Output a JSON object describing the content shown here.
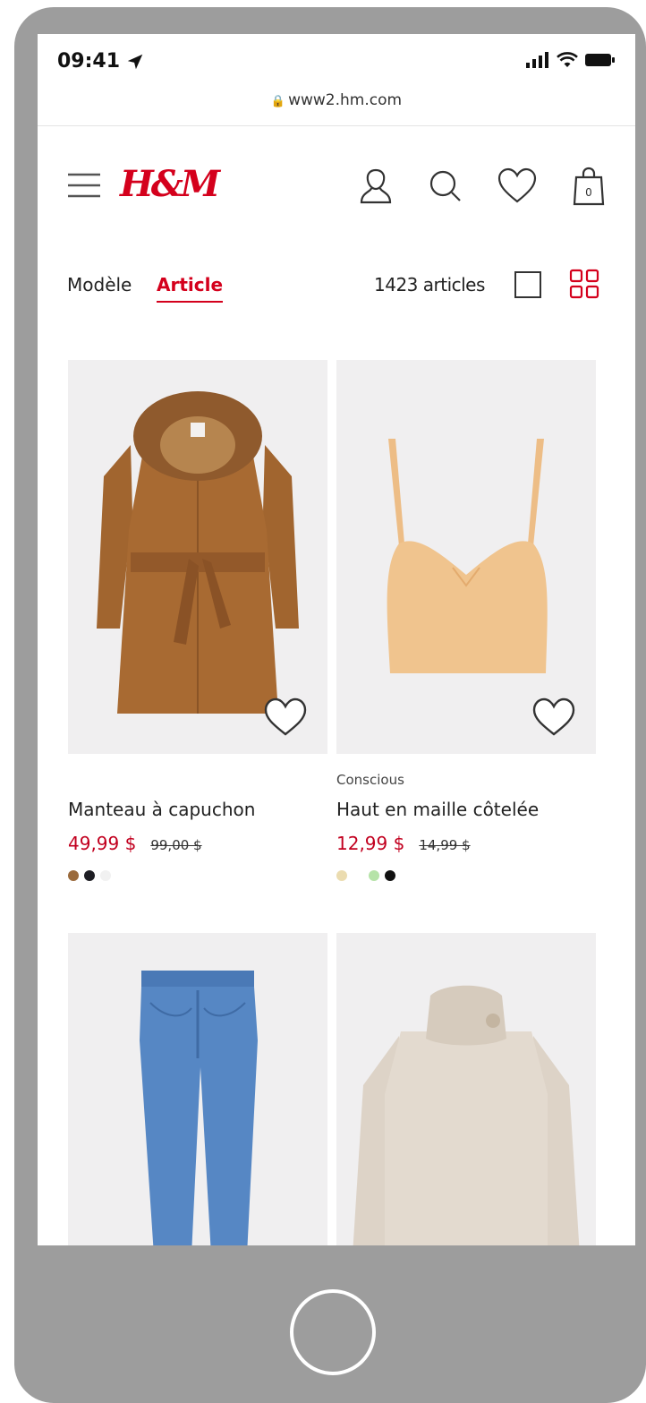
{
  "status_bar": {
    "time": "09:41",
    "url": "www2.hm.com"
  },
  "header": {
    "logo": "H&M",
    "icons": [
      "menu-icon",
      "account-icon",
      "search-icon",
      "heart-icon",
      "bag-icon"
    ],
    "cart_count": "0"
  },
  "filters": {
    "tab_model": "Modèle",
    "tab_article": "Article",
    "active_tab": "Article",
    "count": "1423 articles",
    "view_modes": [
      "single-view-icon",
      "grid-view-icon"
    ],
    "active_view": "grid"
  },
  "colors": {
    "brand_red": "#d4001c",
    "price_red": "#c2001f",
    "frame_gray": "#9d9d9d"
  },
  "products": [
    {
      "tag": "",
      "name": "Manteau à capuchon",
      "price": "49,99 $",
      "old_price": "99,00 $",
      "swatches": [
        "#9a6a3c",
        "#1e1e24",
        "#eeeeee"
      ]
    },
    {
      "tag": "Conscious",
      "name": "Haut en maille côtelée",
      "price": "12,99 $",
      "old_price": "14,99 $",
      "swatches": [
        "#ebdcb0",
        "#ffffff",
        "#b6e3a8",
        "#111111"
      ]
    },
    {
      "tag": "",
      "name": "",
      "price": "",
      "old_price": "",
      "swatches": []
    },
    {
      "tag": "",
      "name": "",
      "price": "",
      "old_price": "",
      "swatches": []
    }
  ]
}
